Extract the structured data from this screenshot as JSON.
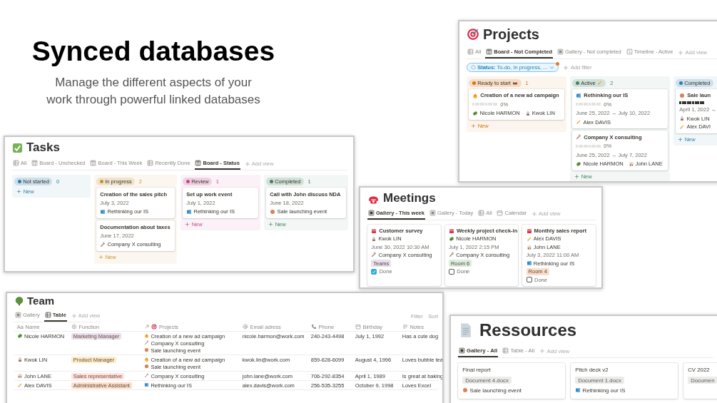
{
  "intro": {
    "title": "Synced databases",
    "subtitle": "Manage the different aspects of your work through powerful linked databases"
  },
  "projects": {
    "title": "Projects",
    "views": [
      {
        "label": "All",
        "kind": "table",
        "selected": false
      },
      {
        "label": "Board - Not Completed",
        "kind": "board",
        "selected": true
      },
      {
        "label": "Gallery - Not completed",
        "kind": "gallery",
        "selected": false
      },
      {
        "label": "Timeline - Active",
        "kind": "timeline",
        "selected": false
      }
    ],
    "add_view": "Add view",
    "filter": {
      "text": "**Status:** To-do, In progress, ...",
      "modified": true
    },
    "add_filter": "Add filter",
    "columns": [
      {
        "name": "Ready to start",
        "kind": "lunchbox",
        "count": "1",
        "color": "#d9730d",
        "cards": [
          {
            "title": {
              "kind": "flame",
              "text": "Creation of a new ad campaign"
            },
            "level": 0,
            "progress": "0%",
            "people": [
              {
                "kind": "leaf",
                "text": "Nicole HARMON"
              },
              {
                "kind": "cup",
                "text": "Kwok LIN"
              }
            ]
          }
        ],
        "new": "New"
      },
      {
        "name": "Active",
        "kind": "pencil",
        "count": "2",
        "color": "#448361",
        "cards": [
          {
            "title": {
              "kind": "book",
              "text": "Rethinking our IS"
            },
            "level": 0,
            "progress": "0%",
            "date": "June 25, 2022 → July 10, 2022",
            "people": [
              {
                "kind": "pencil",
                "text": "Alex DAVIS"
              }
            ]
          },
          {
            "title": {
              "kind": "hammer",
              "text": "Company X consulting"
            },
            "level": 0,
            "progress": "0%",
            "date": "June 25, 2022 → July 7, 2022",
            "people": [
              {
                "kind": "leaf",
                "text": "Nicole HARMON"
              },
              {
                "kind": "chart",
                "text": "John LANE"
              }
            ]
          }
        ],
        "new": "New"
      },
      {
        "name": "Completed",
        "color": "#337ea9",
        "cards": [
          {
            "title": {
              "kind": "ball",
              "text": "Sale laun"
            },
            "level": 1,
            "date": "April 1, 2022 →",
            "people": [
              {
                "kind": "cup",
                "text": "Kwok LIN"
              },
              {
                "kind": "pencil",
                "text": "Alex DAVI"
              }
            ]
          }
        ],
        "new": "New"
      }
    ]
  },
  "tasks": {
    "title": "Tasks",
    "views": [
      {
        "label": "All",
        "kind": "table",
        "selected": false
      },
      {
        "label": "Board - Unchecked",
        "kind": "board",
        "selected": false
      },
      {
        "label": "Board - This Week",
        "kind": "board",
        "selected": false
      },
      {
        "label": "Recently Done",
        "kind": "table",
        "selected": false
      },
      {
        "label": "Board - Status",
        "kind": "board",
        "selected": true
      }
    ],
    "add_view": "Add view",
    "columns": [
      {
        "name": "Not started",
        "count": "0",
        "color": "#337ea9",
        "new": "New"
      },
      {
        "name": "In progress",
        "count": "2",
        "color": "#cb912f",
        "cards": [
          {
            "title": {
              "text": "Creation of the sales pitch"
            },
            "date": "July 3, 2022",
            "project": {
              "kind": "book",
              "text": "Rethinking our IS"
            }
          },
          {
            "title": {
              "text": "Documentation about taxes"
            },
            "date": "June 17, 2022",
            "project": {
              "kind": "hammer",
              "text": "Company X consulting"
            }
          }
        ],
        "new": "New"
      },
      {
        "name": "Review",
        "count": "1",
        "color": "#c14c8a",
        "cards": [
          {
            "title": {
              "text": "Set up work event"
            },
            "date": "July 1, 2022",
            "project": {
              "kind": "book",
              "text": "Rethinking our IS"
            }
          }
        ],
        "new": "New"
      },
      {
        "name": "Completed",
        "count": "1",
        "color": "#448361",
        "cards": [
          {
            "title": {
              "text": "Call with John discuss NDA"
            },
            "date": "June 18, 2022",
            "project": {
              "kind": "ball",
              "text": "Sale launching event"
            }
          }
        ],
        "new": "New"
      }
    ]
  },
  "meetings": {
    "title": "Meetings",
    "views": [
      {
        "label": "Gallery - This week",
        "kind": "gallery",
        "selected": true
      },
      {
        "label": "Gallery - Today",
        "kind": "gallery",
        "selected": false
      },
      {
        "label": "All",
        "kind": "table",
        "selected": false
      },
      {
        "label": "Calendar",
        "kind": "calendar",
        "selected": false
      }
    ],
    "add_view": "Add view",
    "cards": [
      {
        "title": "Customer survey",
        "people": [
          {
            "kind": "cup",
            "text": "Kwok LIN"
          }
        ],
        "datetime": "June 30, 2022 10:30 AM",
        "project": {
          "kind": "hammer",
          "text": "Company X consulting"
        },
        "tag": {
          "text": "Teams",
          "color": "#e8deee"
        },
        "done": {
          "label": "Done",
          "checked": true
        }
      },
      {
        "title": "Weekly project check-in",
        "people": [
          {
            "kind": "leaf",
            "text": "Nicole HARMON"
          }
        ],
        "datetime": "July 1, 2022 2:15 PM",
        "project": {
          "kind": "hammer",
          "text": "Company X consulting"
        },
        "tag": {
          "text": "Room 6",
          "color": "#dbeddb"
        },
        "done": {
          "label": "Done",
          "checked": false
        }
      },
      {
        "title": "Monthly sales report",
        "people": [
          {
            "kind": "pencil",
            "text": "Alex DAVIS"
          },
          {
            "kind": "chart",
            "text": "John LANE"
          }
        ],
        "datetime": "July 3, 2022 11:00 AM",
        "project": {
          "kind": "book",
          "text": "Rethinking our IS"
        },
        "tag": {
          "text": "Room 4",
          "color": "#fadec9"
        },
        "done": {
          "label": "Done",
          "checked": false
        }
      }
    ]
  },
  "team": {
    "title": "Team",
    "views": [
      {
        "label": "Gallery",
        "kind": "gallery",
        "selected": false
      },
      {
        "label": "Table",
        "kind": "table",
        "selected": true
      }
    ],
    "add_view": "Add view",
    "filter": "Filter",
    "sort": "Sort",
    "columns": [
      {
        "label": "Name",
        "icon_text": "Aa"
      },
      {
        "label": "Function",
        "kind": "select"
      },
      {
        "label": "Projects",
        "kind": "relation"
      },
      {
        "label": "Email adress",
        "kind": "email"
      },
      {
        "label": "Phone",
        "kind": "phone"
      },
      {
        "label": "Birthday",
        "kind": "date"
      },
      {
        "label": "Notes",
        "kind": "text"
      }
    ],
    "rows": [
      {
        "name": {
          "kind": "leaf",
          "text": "Nicole HARMON"
        },
        "function": {
          "text": "Marketing Manager",
          "color": "#e8deee"
        },
        "projects": [
          {
            "kind": "flame",
            "text": "Creation of a new ad campaign"
          },
          {
            "kind": "hammer",
            "text": "Company X consulting"
          },
          {
            "kind": "ball",
            "text": "Sale launching event"
          }
        ],
        "email": "nicole.harmon@work.com",
        "phone": "240-243-4498",
        "birthday": "July 1, 1992",
        "notes": "Has a cute dog"
      },
      {
        "name": {
          "kind": "cup",
          "text": "Kwok LIN"
        },
        "function": {
          "text": "Product Manager",
          "color": "#fdecc8"
        },
        "projects": [
          {
            "kind": "flame",
            "text": "Creation of a new ad campaign"
          },
          {
            "kind": "ball",
            "text": "Sale launching event"
          }
        ],
        "email": "kwok.lin@work.com",
        "phone": "859-628-6099",
        "birthday": "August 4, 1996",
        "notes": "Loves bubble tea"
      },
      {
        "name": {
          "kind": "chart",
          "text": "John LANE"
        },
        "function": {
          "text": "Sales representative",
          "color": "#ffe2dd"
        },
        "projects": [
          {
            "kind": "hammer",
            "text": "Company X consulting"
          }
        ],
        "email": "john.lane@work.com",
        "phone": "706-292-8354",
        "birthday": "April 1, 1989",
        "notes": "Is great at baking"
      },
      {
        "name": {
          "kind": "pencil",
          "text": "Alex DAVIS"
        },
        "function": {
          "text": "Administrative Assistant",
          "color": "#fadec9"
        },
        "projects": [
          {
            "kind": "book",
            "text": "Rethinking our IS"
          }
        ],
        "email": "alex.davis@work.com",
        "phone": "256-535-3255",
        "birthday": "October 9, 1998",
        "notes": "Loves Excel"
      }
    ]
  },
  "resources": {
    "title": "Ressources",
    "views": [
      {
        "label": "Gallery - All",
        "kind": "gallery",
        "selected": true
      },
      {
        "label": "Table - All",
        "kind": "table",
        "selected": false
      }
    ],
    "add_view": "Add view",
    "cards": [
      {
        "title": "Final report",
        "file": "Document 4.docx",
        "project": {
          "kind": "ball",
          "text": "Sale launching event"
        }
      },
      {
        "title": "Pitch deck v2",
        "file": "Document 1.docx",
        "project": {
          "kind": "book",
          "text": "Rethinking our IS"
        }
      },
      {
        "title": "CV 2022",
        "file": "Documen"
      }
    ]
  }
}
